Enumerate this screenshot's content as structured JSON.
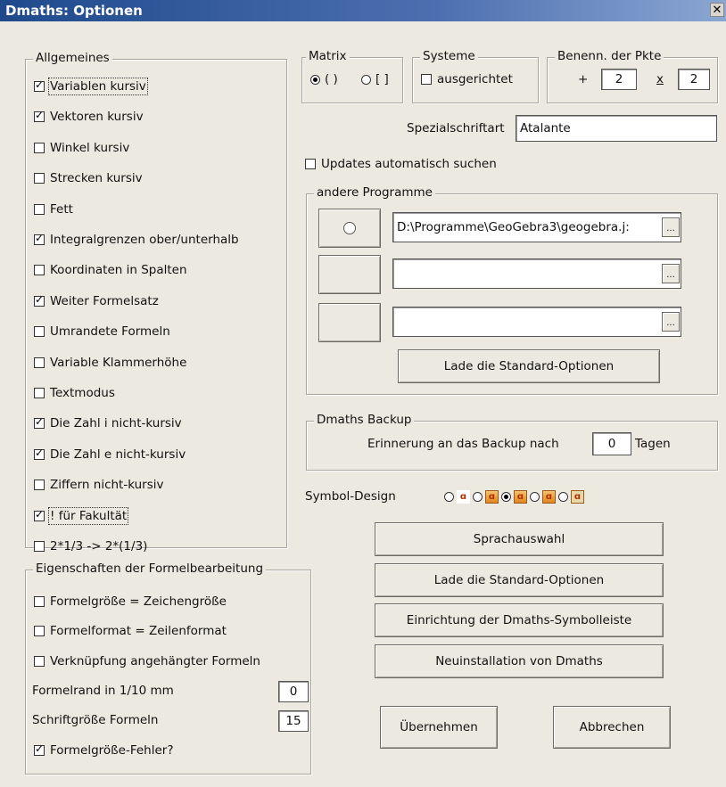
{
  "window": {
    "title": "Dmaths: Optionen",
    "close_label": "✕"
  },
  "allgemeines": {
    "legend": "Allgemeines",
    "items": [
      {
        "label": "Variablen kursiv",
        "checked": true
      },
      {
        "label": "Vektoren kursiv",
        "checked": true
      },
      {
        "label": "Winkel kursiv",
        "checked": false
      },
      {
        "label": "Strecken kursiv",
        "checked": false
      },
      {
        "label": "Fett",
        "checked": false
      },
      {
        "label": "Integralgrenzen ober/unterhalb",
        "checked": true
      },
      {
        "label": "Koordinaten in Spalten",
        "checked": false
      },
      {
        "label": "Weiter Formelsatz",
        "checked": true
      },
      {
        "label": "Umrandete Formeln",
        "checked": false
      },
      {
        "label": "Variable Klammerhöhe",
        "checked": false
      },
      {
        "label": "Textmodus",
        "checked": false
      },
      {
        "label": "Die Zahl  i nicht-kursiv",
        "checked": true
      },
      {
        "label": "Die Zahl  e nicht-kursiv",
        "checked": true
      },
      {
        "label": "Ziffern nicht-kursiv",
        "checked": false
      },
      {
        "label": "! für Fakultät",
        "checked": true
      },
      {
        "label": "2*1/3 -> 2*(1/3)",
        "checked": false
      }
    ]
  },
  "eigenschaften": {
    "legend": "Eigenschaften der Formelbearbeitung",
    "items": [
      {
        "label": "Formelgröße = Zeichengröße",
        "checked": false
      },
      {
        "label": "Formelformat = Zeilenformat",
        "checked": false
      },
      {
        "label": "Verknüpfung angehängter Formeln",
        "checked": false
      }
    ],
    "formelrand_label": "Formelrand in 1/10 mm",
    "formelrand_value": "0",
    "schriftgroesse_label": "Schriftgröße Formeln",
    "schriftgroesse_value": "15",
    "fehler_label": "Formelgröße-Fehler?",
    "fehler_checked": true
  },
  "matrix": {
    "legend": "Matrix",
    "opt1": "( )",
    "opt2": "[ ]",
    "selected": 1
  },
  "systeme": {
    "legend": "Systeme",
    "label": "ausgerichtet",
    "checked": false
  },
  "benennung": {
    "legend": "Benenn. der Pkte",
    "plus_label": "+",
    "plus_value": "2",
    "times_label": "x",
    "times_value": "2"
  },
  "spezial": {
    "label": "Spezialschriftart",
    "value": "Atalante"
  },
  "updates": {
    "label": "Updates automatisch suchen",
    "checked": false
  },
  "programme": {
    "legend": "andere Programme",
    "rows": [
      {
        "icon": "geogebra-icon",
        "path": "D:\\Programme\\GeoGebra3\\geogebra.j:"
      },
      {
        "icon": "",
        "path": ""
      },
      {
        "icon": "",
        "path": ""
      }
    ],
    "browse_label": "...",
    "load_defaults": "Lade die Standard-Optionen"
  },
  "backup": {
    "legend": "Dmaths Backup",
    "label_before": "Erinnerung an das Backup nach",
    "value": "0",
    "label_after": "Tagen"
  },
  "symbol_design": {
    "label": "Symbol-Design",
    "options": 5,
    "selected": 2
  },
  "buttons": {
    "sprachauswahl": "Sprachauswahl",
    "lade_standard": "Lade die Standard-Optionen",
    "symbolleiste": "Einrichtung der Dmaths-Symbolleiste",
    "neuinstallation": "Neuinstallation von Dmaths",
    "uebernehmen": "Übernehmen",
    "abbrechen": "Abbrechen"
  }
}
